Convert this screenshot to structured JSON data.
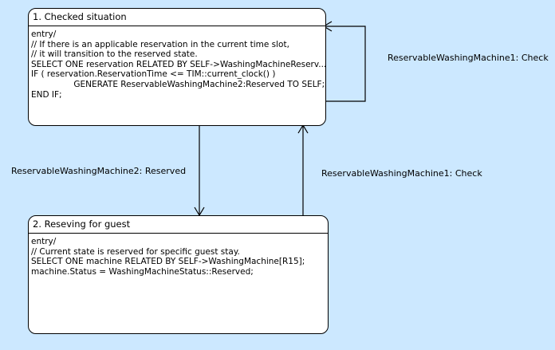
{
  "states": [
    {
      "title": "1. Checked situation",
      "lines": [
        "entry/",
        "// If there is an applicable reservation in the current time slot,",
        "// it will transition to the reserved state.",
        "SELECT ONE reservation RELATED BY SELF->WashingMachineReserv...",
        "IF ( reservation.ReservationTime <= TIM::current_clock() )",
        "                GENERATE ReservableWashingMachine2:Reserved TO SELF;",
        "END IF;"
      ]
    },
    {
      "title": "2. Reseving for guest",
      "lines": [
        "entry/",
        "// Current state is reserved for specific guest stay.",
        "SELECT ONE machine RELATED BY SELF->WashingMachine[R15];",
        "machine.Status = WashingMachineStatus::Reserved;"
      ]
    }
  ],
  "transitions": [
    {
      "label": "ReservableWashingMachine1: Check",
      "from": "1. Checked situation",
      "to": "1. Checked situation"
    },
    {
      "label": "ReservableWashingMachine2: Reserved",
      "from": "1. Checked situation",
      "to": "2. Reseving for guest"
    },
    {
      "label": "ReservableWashingMachine1: Check",
      "from": "2. Reseving for guest",
      "to": "1. Checked situation"
    }
  ]
}
